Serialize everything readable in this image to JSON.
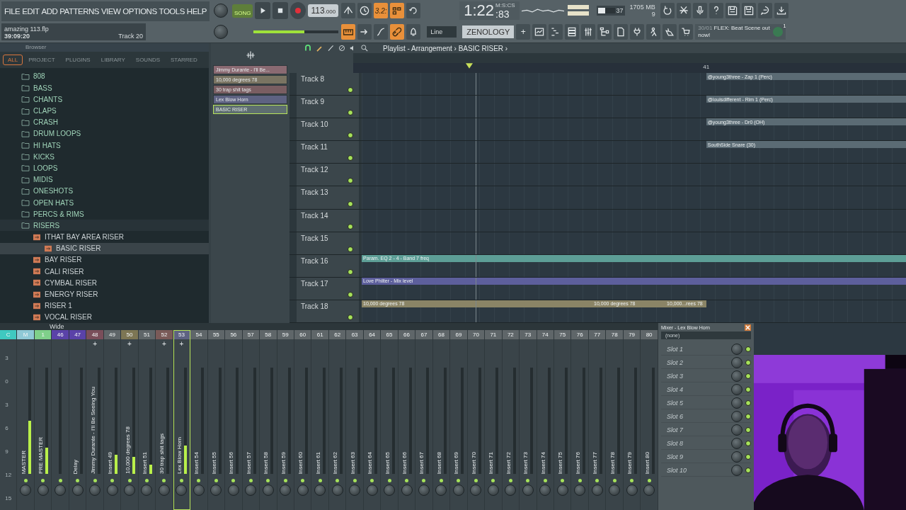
{
  "menu": [
    "FILE",
    "EDIT",
    "ADD",
    "PATTERNS",
    "VIEW",
    "OPTIONS",
    "TOOLS",
    "HELP"
  ],
  "project": {
    "file": "amazing 113.flp",
    "time": "39:09:20",
    "track": "Track 20"
  },
  "transport": {
    "mode": "SONG",
    "song_on": true,
    "tempo": "113",
    "tempo_fraction": ".000",
    "level": 0.6
  },
  "clock": {
    "time": "1:22",
    "centis": ":83",
    "unit": "M:S:CS"
  },
  "cpu": {
    "value": "37",
    "memory": "1705 MB",
    "polyphony": "9",
    "level": 0.45
  },
  "tools_row1": [
    {
      "kind": "sweep",
      "on": false
    },
    {
      "kind": "wait",
      "on": false
    },
    {
      "kind": "countdown",
      "label": "3.2:",
      "on": true
    },
    {
      "kind": "steps",
      "on": true
    },
    {
      "kind": "loop",
      "on": false
    }
  ],
  "tools_row2": [
    {
      "kind": "keys",
      "on": true
    },
    {
      "kind": "arrow",
      "on": false
    },
    {
      "kind": "curve",
      "on": false
    },
    {
      "kind": "link",
      "on": true
    },
    {
      "kind": "bell",
      "on": false
    }
  ],
  "snap": {
    "value": "Line"
  },
  "channel": {
    "name": "ZENOLOGY",
    "add": "+"
  },
  "system_tools": [
    {
      "kind": "undo"
    },
    {
      "kind": "cut"
    },
    {
      "kind": "mic"
    },
    {
      "kind": "help"
    },
    {
      "kind": "save"
    },
    {
      "kind": "save"
    },
    {
      "kind": "chat"
    },
    {
      "kind": "download"
    }
  ],
  "window_tools": [
    {
      "kind": "playlist"
    },
    {
      "kind": "piano"
    },
    {
      "kind": "rack"
    },
    {
      "kind": "mixer"
    },
    {
      "kind": "browser"
    },
    {
      "kind": "pages"
    },
    {
      "kind": "plug"
    },
    {
      "kind": "person"
    },
    {
      "kind": "hand"
    },
    {
      "kind": "cart"
    }
  ],
  "news": {
    "date": "30/01",
    "text": "FLEX: Beat Scene out now!",
    "count": "1"
  },
  "browser": {
    "title": "Browser",
    "tabs": [
      {
        "label": "ALL",
        "selected": true
      },
      {
        "label": "PROJECT",
        "selected": false
      },
      {
        "label": "PLUGINS",
        "selected": false
      },
      {
        "label": "LIBRARY",
        "selected": false
      },
      {
        "label": "SOUNDS",
        "selected": false
      },
      {
        "label": "STARRED",
        "selected": false
      }
    ],
    "tree": [
      {
        "kind": "folder",
        "label": "808",
        "selected": false
      },
      {
        "kind": "folder",
        "label": "BASS",
        "selected": false
      },
      {
        "kind": "folder",
        "label": "CHANTS",
        "selected": false
      },
      {
        "kind": "folder",
        "label": "CLAPS",
        "selected": false
      },
      {
        "kind": "folder",
        "label": "CRASH",
        "selected": false
      },
      {
        "kind": "folder",
        "label": "DRUM LOOPS",
        "selected": false
      },
      {
        "kind": "folder",
        "label": "HI HATS",
        "selected": false
      },
      {
        "kind": "folder",
        "label": "KICKS",
        "selected": false
      },
      {
        "kind": "folder",
        "label": "LOOPS",
        "selected": false
      },
      {
        "kind": "folder",
        "label": "MIDIS",
        "selected": false
      },
      {
        "kind": "folder",
        "label": "ONESHOTS",
        "selected": false
      },
      {
        "kind": "folder",
        "label": "OPEN HATS",
        "selected": false
      },
      {
        "kind": "folder",
        "label": "PERCS & RIMS",
        "selected": false
      },
      {
        "kind": "folder",
        "label": "RISERS",
        "selected": false,
        "children": [
          {
            "kind": "file",
            "label": "ITHAT BAY AREA RISER",
            "selected": false,
            "children": [
              {
                "kind": "file",
                "label": "BASIC RISER",
                "selected": true
              }
            ]
          },
          {
            "kind": "file",
            "label": "BAY RISER",
            "selected": false
          },
          {
            "kind": "file",
            "label": "CALI RISER",
            "selected": false
          },
          {
            "kind": "file",
            "label": "CYMBAL RISER",
            "selected": false
          },
          {
            "kind": "file",
            "label": "ENERGY RISER",
            "selected": false
          },
          {
            "kind": "file",
            "label": "RISER 1",
            "selected": false
          },
          {
            "kind": "file",
            "label": "VOCAL RISER",
            "selected": false
          }
        ]
      }
    ]
  },
  "patterns": [
    {
      "label": "Jimmy Durante - I'll Be...",
      "color": "#8a6a72",
      "selected": false
    },
    {
      "label": "10,000 degrees 78",
      "color": "#7a7462",
      "selected": false
    },
    {
      "label": "30 trap shit tags",
      "color": "#7a5e62",
      "selected": false
    },
    {
      "label": "Lex Blow Horn",
      "color": "#5e6282",
      "selected": false
    },
    {
      "label": "BASIC RISER",
      "color": "#5e6e70",
      "selected": true
    }
  ],
  "playlist": {
    "title": "Playlist - Arrangement › BASIC RISER ›",
    "ruler": [
      "41"
    ],
    "tracks": [
      {
        "name": "Track 8",
        "on": true,
        "clips": [
          {
            "kind": "after_marker",
            "label": "@young3three - Zap 1 (Perc)",
            "color": "#5b6b74"
          }
        ]
      },
      {
        "name": "Track 9",
        "on": true,
        "clips": [
          {
            "kind": "after_marker",
            "label": "@louisdifferent - Rim 1 (Perc)",
            "color": "#5b6b74"
          }
        ]
      },
      {
        "name": "Track 10",
        "on": true,
        "clips": [
          {
            "kind": "after_marker",
            "label": "@young3three - Dr0 (OH)",
            "color": "#5b6b74"
          }
        ]
      },
      {
        "name": "Track 11",
        "on": true,
        "clips": [
          {
            "kind": "after_marker",
            "label": "SouthSide Snare (30)",
            "color": "#5b6b74"
          }
        ]
      },
      {
        "name": "Track 12",
        "on": true
      },
      {
        "name": "Track 13",
        "on": true
      },
      {
        "name": "Track 14",
        "on": true
      },
      {
        "name": "Track 15",
        "on": true
      },
      {
        "name": "Track 16",
        "on": true,
        "clips": [
          {
            "kind": "full",
            "label": "Param. EQ 2 - 4 - Band 7 freq",
            "color": "#5d9e96"
          }
        ]
      },
      {
        "name": "Track 17",
        "on": true,
        "clips": [
          {
            "kind": "full",
            "label": "Love Philter - Mix level",
            "color": "#5d5f9c"
          }
        ]
      },
      {
        "name": "Track 18",
        "on": true,
        "clips": [
          {
            "kind": "before_marker",
            "label": "10,000 degrees 78",
            "color": "#8a8466"
          },
          {
            "kind": "before_marker",
            "label": "10,000 degrees 78",
            "color": "#8a8466"
          },
          {
            "kind": "before_marker",
            "color": "#8a8466"
          },
          {
            "kind": "before_marker",
            "color": "#8a8466"
          },
          {
            "kind": "before_marker",
            "label": "10,000...rees 78",
            "color": "#8a8466"
          }
        ]
      }
    ]
  },
  "mixer": {
    "preset": "Wide",
    "scale": [
      "3",
      "0",
      "3",
      "6",
      "9",
      "12",
      "15"
    ],
    "strips": [
      {
        "kind": "current",
        "number": "C",
        "color": "#3fc9c0",
        "selected": false
      },
      {
        "kind": "insert",
        "number": "M",
        "name": "MASTER",
        "color": "#8fc9d6",
        "selected": false,
        "level": 0.5
      },
      {
        "kind": "insert",
        "number": "1",
        "name": "PRE MASTER",
        "color": "#7fd08a",
        "selected": false,
        "level": 0.25
      },
      {
        "kind": "insert",
        "number": "46",
        "color": "#5a42a8",
        "selected": false
      },
      {
        "kind": "insert",
        "number": "47",
        "name": "Delay",
        "color": "#5a42a8",
        "selected": false
      },
      {
        "kind": "insert",
        "number": "48",
        "name": "Jimmy Durante - I'll Be Seeing You",
        "color": "#7a4e5a",
        "send": "+",
        "selected": false
      },
      {
        "kind": "insert",
        "number": "49",
        "name": "Insert 49",
        "color": "#5f6669",
        "selected": false,
        "level": 0.18
      },
      {
        "kind": "insert",
        "number": "50",
        "name": "10,000 degrees 78",
        "color": "#7d7654",
        "send": "+",
        "selected": false,
        "level": 0.16
      },
      {
        "kind": "insert",
        "number": "51",
        "name": "Insert 51",
        "color": "#5f6669",
        "selected": false,
        "level": 0.09
      },
      {
        "kind": "insert",
        "number": "52",
        "name": "30 trap shit tags",
        "color": "#7a5a58",
        "send": "+",
        "selected": false
      },
      {
        "kind": "insert",
        "number": "53",
        "name": "Lex Blow Horn",
        "color": "#5e6282",
        "send": "+",
        "selected": true,
        "level": 0.27
      },
      {
        "kind": "insert",
        "number": "54",
        "name": "Insert 54",
        "color": "#5f6669",
        "selected": false
      },
      {
        "kind": "insert",
        "number": "55",
        "name": "Insert 55",
        "color": "#5f6669",
        "selected": false
      },
      {
        "kind": "insert",
        "number": "56",
        "name": "Insert 56",
        "color": "#5f6669",
        "selected": false
      },
      {
        "kind": "insert",
        "number": "57",
        "name": "Insert 57",
        "color": "#5f6669",
        "selected": false
      },
      {
        "kind": "insert",
        "number": "58",
        "name": "Insert 58",
        "color": "#5f6669",
        "selected": false
      },
      {
        "kind": "insert",
        "number": "59",
        "name": "Insert 59",
        "color": "#5f6669",
        "selected": false
      },
      {
        "kind": "insert",
        "number": "60",
        "name": "Insert 60",
        "color": "#5f6669",
        "selected": false
      },
      {
        "kind": "insert",
        "number": "61",
        "name": "Insert 61",
        "color": "#5f6669",
        "selected": false
      },
      {
        "kind": "insert",
        "number": "62",
        "name": "Insert 62",
        "color": "#5f6669",
        "selected": false
      },
      {
        "kind": "insert",
        "number": "63",
        "name": "Insert 63",
        "color": "#5f6669",
        "selected": false
      },
      {
        "kind": "insert",
        "number": "64",
        "name": "Insert 64",
        "color": "#5f6669",
        "selected": false
      },
      {
        "kind": "insert",
        "number": "65",
        "name": "Insert 65",
        "color": "#5f6669",
        "selected": false
      },
      {
        "kind": "insert",
        "number": "66",
        "name": "Insert 66",
        "color": "#5f6669",
        "selected": false
      },
      {
        "kind": "insert",
        "number": "67",
        "name": "Insert 67",
        "color": "#5f6669",
        "selected": false
      },
      {
        "kind": "insert",
        "number": "68",
        "name": "Insert 68",
        "color": "#5f6669",
        "selected": false
      },
      {
        "kind": "insert",
        "number": "69",
        "name": "Insert 69",
        "color": "#5f6669",
        "selected": false
      },
      {
        "kind": "insert",
        "number": "70",
        "name": "Insert 70",
        "color": "#5f6669",
        "selected": false
      },
      {
        "kind": "insert",
        "number": "71",
        "name": "Insert 71",
        "color": "#5f6669",
        "selected": false
      },
      {
        "kind": "insert",
        "number": "72",
        "name": "Insert 72",
        "color": "#5f6669",
        "selected": false
      },
      {
        "kind": "insert",
        "number": "73",
        "name": "Insert 73",
        "color": "#5f6669",
        "selected": false
      },
      {
        "kind": "insert",
        "number": "74",
        "name": "Insert 74",
        "color": "#5f6669",
        "selected": false
      },
      {
        "kind": "insert",
        "number": "75",
        "name": "Insert 75",
        "color": "#5f6669",
        "selected": false
      },
      {
        "kind": "insert",
        "number": "76",
        "name": "Insert 76",
        "color": "#5f6669",
        "selected": false
      },
      {
        "kind": "insert",
        "number": "77",
        "name": "Insert 77",
        "color": "#5f6669",
        "selected": false
      },
      {
        "kind": "insert",
        "number": "78",
        "name": "Insert 78",
        "color": "#5f6669",
        "selected": false
      },
      {
        "kind": "insert",
        "number": "79",
        "name": "Insert 79",
        "color": "#5f6669",
        "selected": false
      },
      {
        "kind": "insert",
        "number": "80",
        "name": "Insert 80",
        "color": "#5f6669",
        "selected": false
      }
    ]
  },
  "mixer_panel": {
    "title": "Mixer - Lex Blow Horn",
    "preset": "(none)",
    "slots": [
      {
        "label": "Slot 1",
        "on": true
      },
      {
        "label": "Slot 2",
        "on": true
      },
      {
        "label": "Slot 3",
        "on": true
      },
      {
        "label": "Slot 4",
        "on": true
      },
      {
        "label": "Slot 5",
        "on": true
      },
      {
        "label": "Slot 6",
        "on": true
      },
      {
        "label": "Slot 7",
        "on": true
      },
      {
        "label": "Slot 8",
        "on": true
      },
      {
        "label": "Slot 9",
        "on": true
      },
      {
        "label": "Slot 10",
        "on": true
      }
    ]
  }
}
